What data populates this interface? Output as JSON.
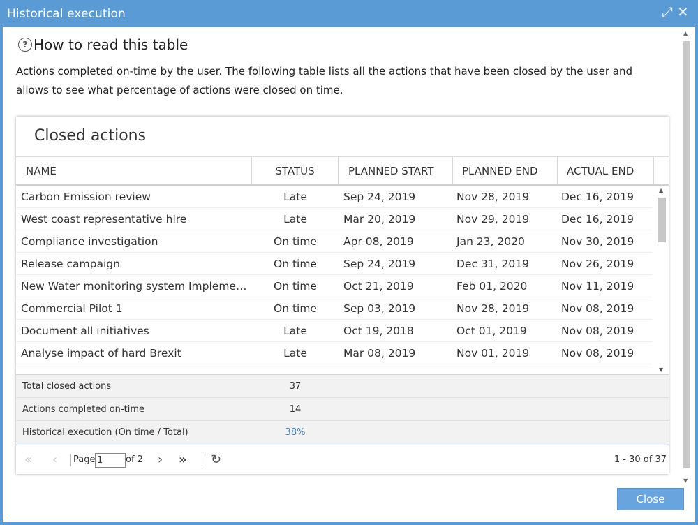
{
  "window": {
    "title": "Historical execution"
  },
  "help": {
    "title": "How to read this table",
    "description": "Actions completed on-time by the user. The following table lists all the actions that have been closed by the user and allows to see what percentage of actions were closed on time."
  },
  "panel": {
    "title": "Closed actions",
    "columns": [
      "NAME",
      "STATUS",
      "PLANNED START",
      "PLANNED END",
      "ACTUAL END"
    ],
    "rows": [
      [
        "Carbon Emission review",
        "Late",
        "Sep 24, 2019",
        "Nov 28, 2019",
        "Dec 16, 2019"
      ],
      [
        "West coast representative hire",
        "Late",
        "Mar 20, 2019",
        "Nov 29, 2019",
        "Dec 16, 2019"
      ],
      [
        "Compliance investigation",
        "On time",
        "Apr 08, 2019",
        "Jan 23, 2020",
        "Nov 30, 2019"
      ],
      [
        "Release campaign",
        "On time",
        "Sep 24, 2019",
        "Dec 31, 2019",
        "Nov 26, 2019"
      ],
      [
        "New Water monitoring system Implementation",
        "On time",
        "Oct 21, 2019",
        "Feb 01, 2020",
        "Nov 11, 2019"
      ],
      [
        "Commercial Pilot 1",
        "On time",
        "Sep 03, 2019",
        "Nov 28, 2019",
        "Nov 08, 2019"
      ],
      [
        "Document all initiatives",
        "Late",
        "Oct 19, 2018",
        "Oct 01, 2019",
        "Nov 08, 2019"
      ],
      [
        "Analyse impact of hard Brexit",
        "Late",
        "Mar 08, 2019",
        "Nov 01, 2019",
        "Nov 08, 2019"
      ]
    ],
    "summary": [
      {
        "label": "Total closed actions",
        "value": "37"
      },
      {
        "label": "Actions completed on-time",
        "value": "14"
      },
      {
        "label": "Historical execution (On time / Total)",
        "value": "38%"
      }
    ]
  },
  "pager": {
    "page_label": "Page",
    "current_page": "1",
    "of_label": "of 2",
    "display": "1 - 30 of 37"
  },
  "footer": {
    "close_label": "Close"
  },
  "colors": {
    "titlebar": "#5b9bd5",
    "button": "#6aa4de",
    "accent_value": "#4a7fb0"
  }
}
